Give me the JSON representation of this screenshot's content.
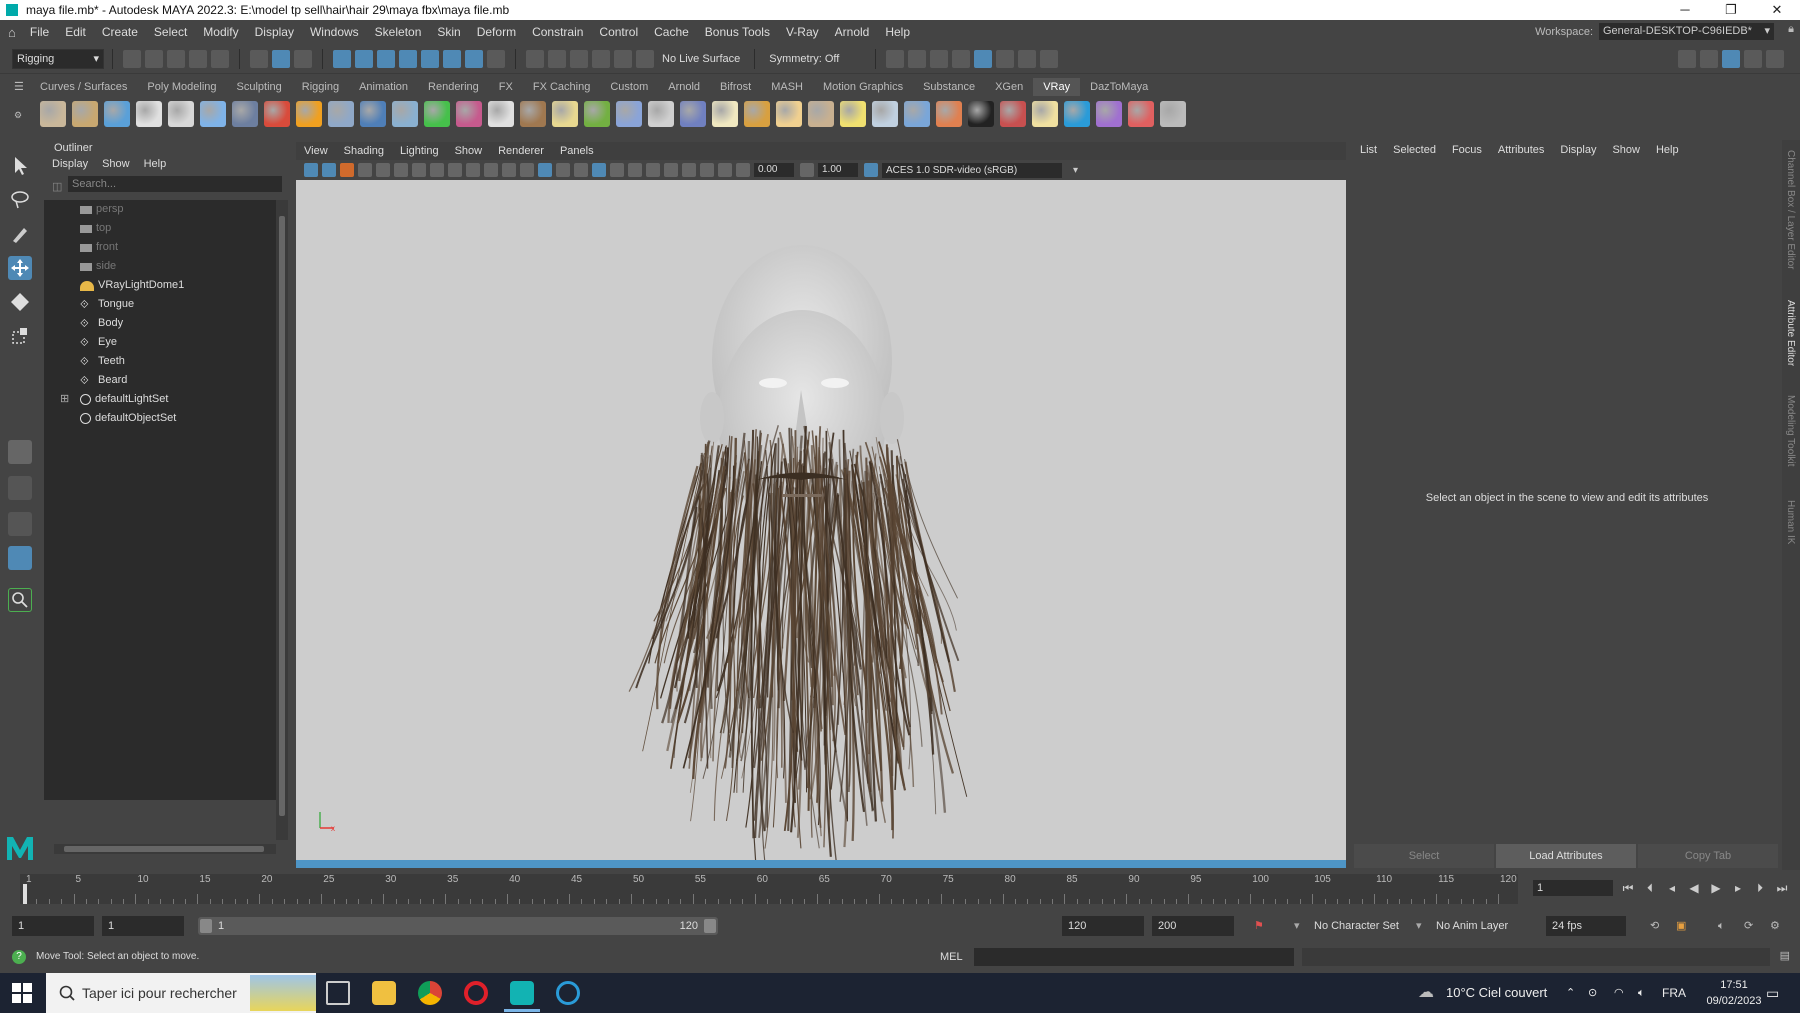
{
  "window": {
    "title": "maya file.mb* - Autodesk MAYA 2022.3: E:\\model tp sell\\hair\\hair 29\\maya fbx\\maya file.mb"
  },
  "menubar": {
    "items": [
      "File",
      "Edit",
      "Create",
      "Select",
      "Modify",
      "Display",
      "Windows",
      "Skeleton",
      "Skin",
      "Deform",
      "Constrain",
      "Control",
      "Cache",
      "Bonus Tools",
      "V-Ray",
      "Arnold",
      "Help"
    ],
    "workspace_label": "Workspace:",
    "workspace_value": "General-DESKTOP-C96IEDB*"
  },
  "statusline": {
    "mode": "Rigging",
    "live_surface": "No Live Surface",
    "symmetry": "Symmetry: Off"
  },
  "shelf": {
    "tabs": [
      "Curves / Surfaces",
      "Poly Modeling",
      "Sculpting",
      "Rigging",
      "Animation",
      "Rendering",
      "FX",
      "FX Caching",
      "Custom",
      "Arnold",
      "Bifrost",
      "MASH",
      "Motion Graphics",
      "Substance",
      "XGen",
      "VRay",
      "DazToMaya"
    ],
    "active_tab": "VRay",
    "icon_colors": [
      "#c9b79a",
      "#c8a871",
      "#5aa0d8",
      "#e0e0e0",
      "#d8d8d8",
      "#7fb3e8",
      "#6d7fa0",
      "#d94b3b",
      "#f0a020",
      "#8fa8c8",
      "#4f7fb8",
      "#8ab0d0",
      "#46c04b",
      "#c65a8d",
      "#e0e0e0",
      "#a07850",
      "#e8d890",
      "#73b042",
      "#8aa4d8",
      "#d0d0d0",
      "#7080c0",
      "#f0e8c0",
      "#d8a040",
      "#f0d090",
      "#c8b090",
      "#f0e070",
      "#c0d0e0",
      "#7aa6d8",
      "#e08050",
      "#222222",
      "#c85050",
      "#f0e0a0",
      "#2a9bd8",
      "#a070d0",
      "#e06060",
      "#bbbbbb"
    ]
  },
  "outliner": {
    "title": "Outliner",
    "menus": [
      "Display",
      "Show",
      "Help"
    ],
    "search_placeholder": "Search...",
    "items": [
      {
        "label": "persp",
        "type": "camera"
      },
      {
        "label": "top",
        "type": "camera"
      },
      {
        "label": "front",
        "type": "camera"
      },
      {
        "label": "side",
        "type": "camera"
      },
      {
        "label": "VRayLightDome1",
        "type": "light"
      },
      {
        "label": "Tongue",
        "type": "mesh"
      },
      {
        "label": "Body",
        "type": "mesh"
      },
      {
        "label": "Eye",
        "type": "mesh"
      },
      {
        "label": "Teeth",
        "type": "mesh"
      },
      {
        "label": "Beard",
        "type": "mesh"
      },
      {
        "label": "defaultLightSet",
        "type": "set",
        "expandable": true
      },
      {
        "label": "defaultObjectSet",
        "type": "set"
      }
    ]
  },
  "viewport": {
    "menus": [
      "View",
      "Shading",
      "Lighting",
      "Show",
      "Renderer",
      "Panels"
    ],
    "exposure": "0.00",
    "gamma": "1.00",
    "color_space": "ACES 1.0 SDR-video (sRGB)"
  },
  "attribute_editor": {
    "menus": [
      "List",
      "Selected",
      "Focus",
      "Attributes",
      "Display",
      "Show",
      "Help"
    ],
    "message": "Select an object in the scene to view and edit its attributes",
    "buttons": [
      "Select",
      "Load Attributes",
      "Copy Tab"
    ],
    "side_tabs": [
      "Channel Box / Layer Editor",
      "Attribute Editor",
      "Modeling Toolkit",
      "Human IK"
    ]
  },
  "timeslider": {
    "ticks": [
      "1",
      "5",
      "10",
      "15",
      "20",
      "25",
      "30",
      "35",
      "40",
      "45",
      "50",
      "55",
      "60",
      "65",
      "70",
      "75",
      "80",
      "85",
      "90",
      "95",
      "100",
      "105",
      "110",
      "115",
      "120"
    ],
    "current_frame": "1"
  },
  "rangeslider": {
    "start": "1",
    "anim_start": "1",
    "range_start_label": "1",
    "range_end_label": "120",
    "playback_end": "120",
    "anim_end": "200",
    "character_set": "No Character Set",
    "anim_layer": "No Anim Layer",
    "fps": "24 fps"
  },
  "helpline": {
    "text": "Move Tool: Select an object to move.",
    "script_lang": "MEL"
  },
  "taskbar": {
    "search_placeholder": "Taper ici pour rechercher",
    "weather": "10°C  Ciel couvert",
    "lang": "FRA",
    "time": "17:51",
    "date": "09/02/2023"
  }
}
